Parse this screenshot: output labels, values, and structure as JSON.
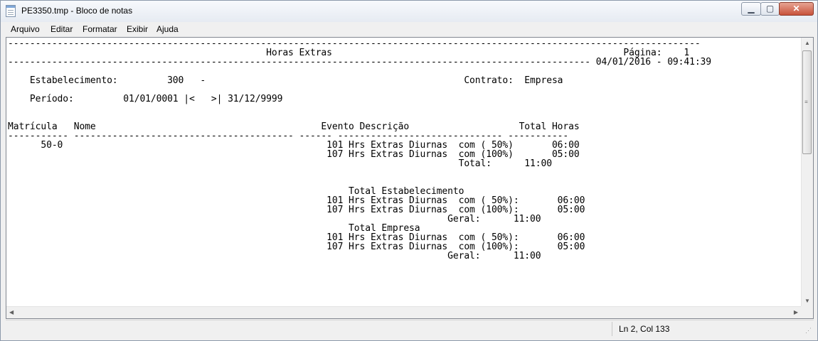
{
  "window": {
    "title": "PE3350.tmp - Bloco de notas",
    "min_label": "▁",
    "max_label": "▢",
    "close_label": "✕"
  },
  "menu": {
    "items": [
      "Arquivo",
      "Editar",
      "Formatar",
      "Exibir",
      "Ajuda"
    ]
  },
  "document": {
    "lines": [
      "------------------------------------------------------------------------------------------------------------------------------",
      "                                               Horas Extras                                                     Página:    1",
      "---------------------------------------------------------------------------------------------------------- 04/01/2016 - 09:41:39",
      "",
      "    Estabelecimento:         300   -                                               Contrato:  Empresa",
      "",
      "    Período:         01/01/0001 |<   >| 31/12/9999",
      "",
      "",
      "Matrícula   Nome                                         Evento Descrição                    Total Horas",
      "----------- ---------------------------------------- ------ ------------------------------ -----------",
      "      50-0                                                101 Hrs Extras Diurnas  com ( 50%)       06:00",
      "                                                          107 Hrs Extras Diurnas  com (100%)       05:00",
      "                                                                                  Total:      11:00",
      "",
      "",
      "                                                              Total Estabelecimento",
      "                                                          101 Hrs Extras Diurnas  com ( 50%):       06:00",
      "                                                          107 Hrs Extras Diurnas  com (100%):       05:00",
      "                                                                                Geral:      11:00",
      "                                                              Total Empresa",
      "                                                          101 Hrs Extras Diurnas  com ( 50%):       06:00",
      "                                                          107 Hrs Extras Diurnas  com (100%):       05:00",
      "                                                                                Geral:      11:00"
    ]
  },
  "status": {
    "position": "Ln 2, Col 133"
  }
}
